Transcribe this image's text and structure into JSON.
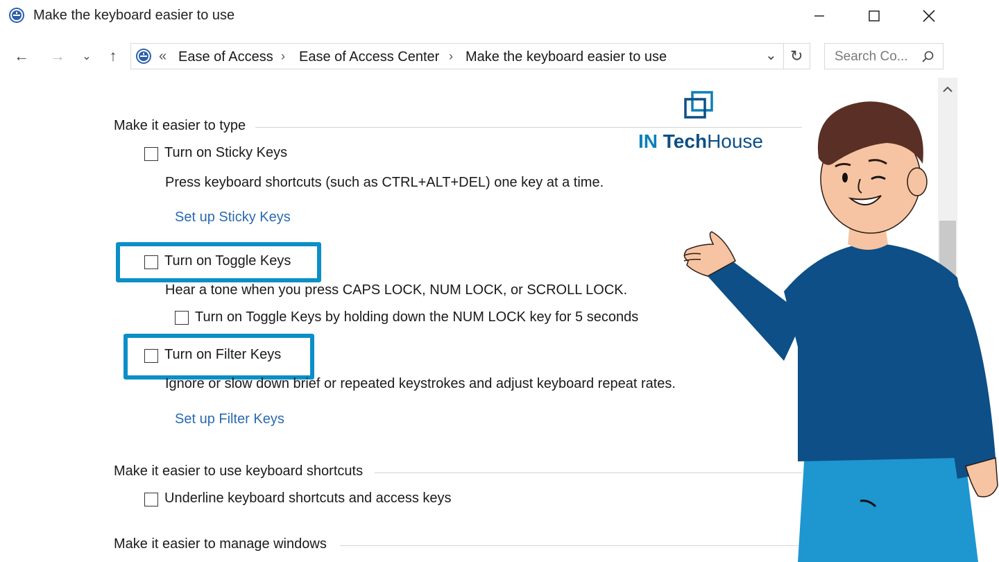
{
  "window": {
    "title": "Make the keyboard easier to use",
    "minimize": "—",
    "maximize": "☐",
    "close": "✕"
  },
  "nav": {
    "back": "←",
    "forward": "→",
    "recent": "⌄",
    "up": "↑",
    "overflow": "«",
    "breadcrumbs": [
      "Ease of Access",
      "Ease of Access Center",
      "Make the keyboard easier to use"
    ],
    "separator": "›",
    "dropdown": "⌄",
    "refresh": "↻",
    "search_placeholder": "Search Co...",
    "search_icon": "⌕"
  },
  "content": {
    "sections": {
      "type": "Make it easier to type",
      "shortcuts": "Make it easier to use keyboard shortcuts",
      "windows": "Make it easier to manage windows"
    },
    "sticky": {
      "label": "Turn on Sticky Keys",
      "checked": false,
      "desc": "Press keyboard shortcuts (such as CTRL+ALT+DEL) one key at a time.",
      "link": "Set up Sticky Keys"
    },
    "toggle": {
      "label": "Turn on Toggle Keys",
      "checked": false,
      "desc": "Hear a tone when you press CAPS LOCK, NUM LOCK, or SCROLL LOCK.",
      "sub_label": "Turn on Toggle Keys by holding down the NUM LOCK key for 5 seconds"
    },
    "filter": {
      "label": "Turn on Filter Keys",
      "checked": false,
      "desc": "Ignore or slow down brief or repeated keystrokes and adjust keyboard repeat rates.",
      "link": "Set up Filter Keys"
    },
    "underline": {
      "label": "Underline keyboard shortcuts and access keys",
      "checked": false
    }
  },
  "brand": {
    "part1": "IN",
    "part2": "Tech",
    "part3": "House",
    "icon": "logo-squares"
  },
  "colors": {
    "highlight": "#0a8fc6",
    "link": "#2a6ab0",
    "sweater": "#0d4f86",
    "pants": "#1e96d0",
    "hair": "#5a2f25",
    "skin": "#f6c4a2"
  }
}
